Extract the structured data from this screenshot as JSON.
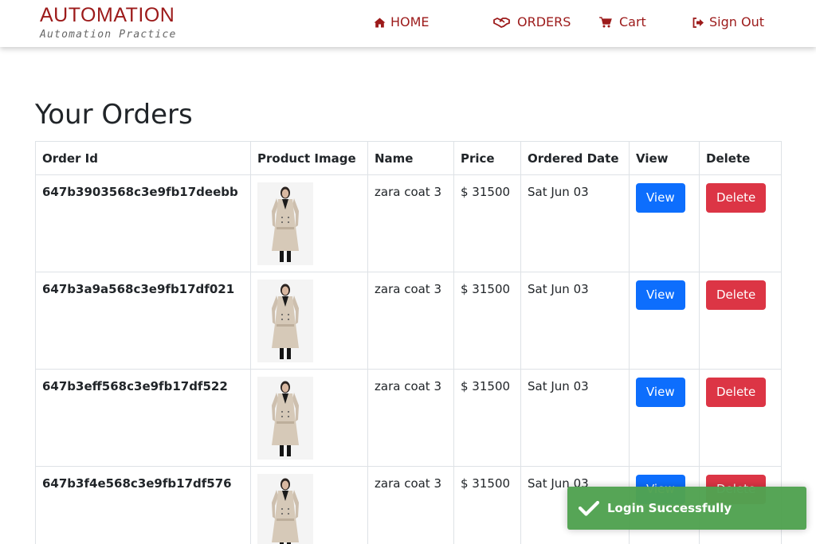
{
  "header": {
    "brand_title": "AUTOMATION",
    "brand_subtitle": "Automation Practice",
    "nav": {
      "home": "HOME",
      "orders": "ORDERS",
      "cart": "Cart",
      "signout": "Sign Out"
    },
    "brand_color": "#9c1a1a"
  },
  "main": {
    "title": "Your Orders",
    "columns": [
      "Order Id",
      "Product Image",
      "Name",
      "Price",
      "Ordered Date",
      "View",
      "Delete"
    ],
    "rows": [
      {
        "order_id": "647b3903568c3e9fb17deebb",
        "name": "zara coat 3",
        "price": "$ 31500",
        "date": "Sat Jun 03",
        "view": "View",
        "delete": "Delete"
      },
      {
        "order_id": "647b3a9a568c3e9fb17df021",
        "name": "zara coat 3",
        "price": "$ 31500",
        "date": "Sat Jun 03",
        "view": "View",
        "delete": "Delete"
      },
      {
        "order_id": "647b3eff568c3e9fb17df522",
        "name": "zara coat 3",
        "price": "$ 31500",
        "date": "Sat Jun 03",
        "view": "View",
        "delete": "Delete"
      },
      {
        "order_id": "647b3f4e568c3e9fb17df576",
        "name": "zara coat 3",
        "price": "$ 31500",
        "date": "Sat Jun 03",
        "view": "View",
        "delete": "Delete"
      }
    ]
  },
  "toast": {
    "message": "Login Successfully",
    "color": "#51a351"
  },
  "icons": {
    "home": "home-icon",
    "orders": "handshake-icon",
    "cart": "cart-icon",
    "signout": "sign-out-icon",
    "toast": "check-icon"
  }
}
